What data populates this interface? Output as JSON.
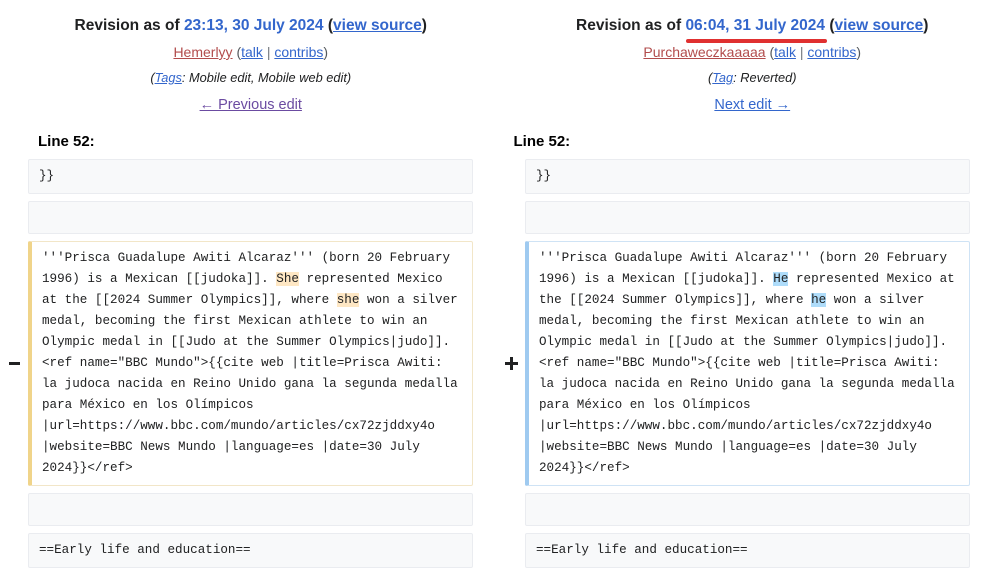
{
  "colors": {
    "link": "#3366cc",
    "visited_link": "#6b4ba1",
    "red_user_link": "#b24c4c",
    "annotation_red": "#e03030",
    "deleted_highlight": "#fee7c4",
    "added_highlight": "#aedcfa",
    "deleted_border": "#f0d48a",
    "added_border": "#9fcaf0",
    "context_background": "#f8f9fa"
  },
  "left": {
    "revision_prefix": "Revision as of ",
    "revision_timestamp": "23:13, 30 July 2024",
    "view_source": "view source",
    "open_paren": "(",
    "close_paren": ")",
    "username": "Hemerlyy",
    "talk": "talk",
    "contribs": "contribs",
    "separator": "|",
    "tags_label": "Tags",
    "tags_value": "Mobile edit, Mobile web edit",
    "tags_full": "(Tags: Mobile edit, Mobile web edit)",
    "nav_label": "← Previous edit",
    "line_header": "Line 52:",
    "has_red_underline": false
  },
  "right": {
    "revision_prefix": "Revision as of ",
    "revision_timestamp": "06:04, 31 July 2024",
    "view_source": "view source",
    "open_paren": "(",
    "close_paren": ")",
    "username": "Purchaweczkaaaaa",
    "talk": "talk",
    "contribs": "contribs",
    "separator": "|",
    "tags_label": "Tag",
    "tags_value": "Reverted",
    "tags_full": "(Tag: Reverted)",
    "nav_label": "Next edit →",
    "line_header": "Line 52:",
    "has_red_underline": true
  },
  "diff_rows": [
    {
      "type": "context",
      "left_marker": "",
      "right_marker": "",
      "left_text": "}}",
      "right_text": "}}"
    },
    {
      "type": "blank",
      "left_marker": "",
      "right_marker": "",
      "left_text": "",
      "right_text": ""
    },
    {
      "type": "change",
      "left_marker": "−",
      "right_marker": "+",
      "left_segments": [
        {
          "text": "'''Prisca Guadalupe Awiti Alcaraz''' (born 20 February 1996) is a Mexican [[judoka]]. ",
          "highlight": false
        },
        {
          "text": "She",
          "highlight": true
        },
        {
          "text": " represented Mexico at the [[2024 Summer Olympics]], where ",
          "highlight": false
        },
        {
          "text": "she",
          "highlight": true
        },
        {
          "text": " won a silver medal, becoming the first Mexican athlete to win an Olympic medal in [[Judo at the Summer Olympics|judo]].<ref name=\"BBC Mundo\">{{cite web |title=Prisca Awiti: la judoca nacida en Reino Unido gana la segunda medalla para México en los Olímpicos |url=https://www.bbc.com/mundo/articles/cx72zjddxy4o |website=BBC News Mundo |language=es |date=30 July 2024}}</ref>",
          "highlight": false
        }
      ],
      "right_segments": [
        {
          "text": "'''Prisca Guadalupe Awiti Alcaraz''' (born 20 February 1996) is a Mexican [[judoka]]. ",
          "highlight": false
        },
        {
          "text": "He",
          "highlight": true
        },
        {
          "text": " represented Mexico at the [[2024 Summer Olympics]], where ",
          "highlight": false
        },
        {
          "text": "he",
          "highlight": true
        },
        {
          "text": " won a silver medal, becoming the first Mexican athlete to win an Olympic medal in [[Judo at the Summer Olympics|judo]].<ref name=\"BBC Mundo\">{{cite web |title=Prisca Awiti: la judoca nacida en Reino Unido gana la segunda medalla para México en los Olímpicos |url=https://www.bbc.com/mundo/articles/cx72zjddxy4o |website=BBC News Mundo |language=es |date=30 July 2024}}</ref>",
          "highlight": false
        }
      ]
    },
    {
      "type": "blank",
      "left_marker": "",
      "right_marker": "",
      "left_text": "",
      "right_text": ""
    },
    {
      "type": "context",
      "left_marker": "",
      "right_marker": "",
      "left_text": "==Early life and education==",
      "right_text": "==Early life and education=="
    }
  ]
}
